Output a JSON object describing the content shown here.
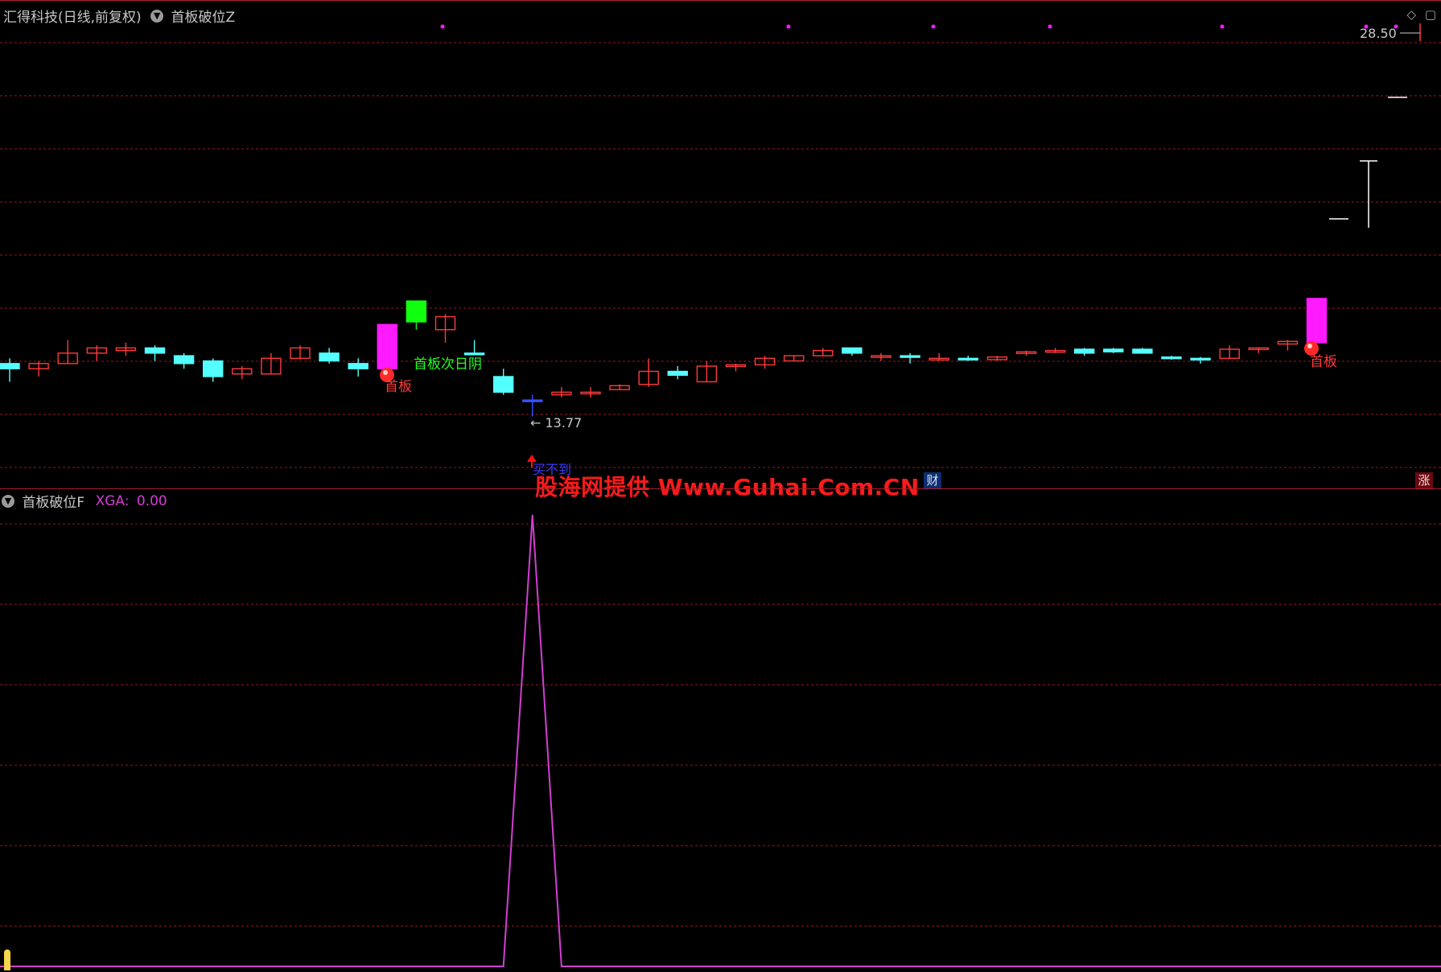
{
  "top_panel": {
    "stock_title": "汇得科技(日线,前复权)",
    "indicator_name": "首板破位Z",
    "top_price": "28.50",
    "low_price_label": "13.77",
    "signal_labels": {
      "first_board_1": "首板",
      "first_board_2": "首板",
      "next_day_yin": "首板次日阴",
      "break_label": "买不到"
    }
  },
  "bottom_panel": {
    "indicator_name": "首板破位F",
    "xga_label": "XGA:",
    "xga_value": "0.00"
  },
  "watermark": "股海网提供 Www.Guhai.Com.CN",
  "badges": {
    "cai": "财",
    "zhang": "涨"
  },
  "icons": [
    "chevron-down-icon",
    "diamond-icon",
    "window-restore-icon"
  ],
  "colors": {
    "up": "#ff3a3a",
    "down": "#54ffff",
    "limit_up": "#ff1aff",
    "green": "#11ff11",
    "grid": "#a0141c",
    "indicator_line": "#d23fd2"
  },
  "chart_data": [
    {
      "type": "candlestick",
      "title": "汇得科技(日线,前复权)",
      "series": [
        {
          "o": 15.8,
          "h": 16.0,
          "l": 15.1,
          "c": 15.6,
          "d": "down"
        },
        {
          "o": 15.6,
          "h": 15.9,
          "l": 15.3,
          "c": 15.8,
          "d": "up"
        },
        {
          "o": 15.8,
          "h": 16.7,
          "l": 15.8,
          "c": 16.2,
          "d": "up"
        },
        {
          "o": 16.2,
          "h": 16.5,
          "l": 15.9,
          "c": 16.4,
          "d": "up"
        },
        {
          "o": 16.3,
          "h": 16.6,
          "l": 16.1,
          "c": 16.4,
          "d": "up"
        },
        {
          "o": 16.4,
          "h": 16.5,
          "l": 15.9,
          "c": 16.2,
          "d": "down"
        },
        {
          "o": 16.1,
          "h": 16.2,
          "l": 15.6,
          "c": 15.8,
          "d": "down"
        },
        {
          "o": 15.9,
          "h": 16.0,
          "l": 15.1,
          "c": 15.3,
          "d": "down"
        },
        {
          "o": 15.4,
          "h": 15.7,
          "l": 15.2,
          "c": 15.6,
          "d": "up"
        },
        {
          "o": 15.4,
          "h": 16.2,
          "l": 15.4,
          "c": 16.0,
          "d": "up"
        },
        {
          "o": 16.0,
          "h": 16.5,
          "l": 16.0,
          "c": 16.4,
          "d": "up"
        },
        {
          "o": 16.2,
          "h": 16.4,
          "l": 15.8,
          "c": 15.9,
          "d": "down"
        },
        {
          "o": 15.8,
          "h": 16.0,
          "l": 15.3,
          "c": 15.6,
          "d": "down"
        },
        {
          "o": 15.6,
          "h": 17.3,
          "l": 15.6,
          "c": 17.3,
          "d": "limit"
        },
        {
          "o": 18.2,
          "h": 18.2,
          "l": 17.1,
          "c": 17.4,
          "d": "green"
        },
        {
          "o": 17.1,
          "h": 17.7,
          "l": 16.6,
          "c": 17.6,
          "d": "up"
        },
        {
          "o": 16.2,
          "h": 16.7,
          "l": 16.2,
          "c": 16.2,
          "d": "down"
        },
        {
          "o": 15.3,
          "h": 15.6,
          "l": 14.6,
          "c": 14.7,
          "d": "down"
        },
        {
          "o": 14.4,
          "h": 14.6,
          "l": 13.77,
          "c": 14.4,
          "d": "blue"
        },
        {
          "o": 14.6,
          "h": 14.9,
          "l": 14.5,
          "c": 14.7,
          "d": "up"
        },
        {
          "o": 14.7,
          "h": 14.9,
          "l": 14.5,
          "c": 14.7,
          "d": "up"
        },
        {
          "o": 14.8,
          "h": 15.0,
          "l": 14.8,
          "c": 14.95,
          "d": "up"
        },
        {
          "o": 15.0,
          "h": 16.0,
          "l": 14.9,
          "c": 15.5,
          "d": "up"
        },
        {
          "o": 15.5,
          "h": 15.7,
          "l": 15.2,
          "c": 15.35,
          "d": "down"
        },
        {
          "o": 15.1,
          "h": 15.9,
          "l": 15.1,
          "c": 15.7,
          "d": "up"
        },
        {
          "o": 15.7,
          "h": 15.8,
          "l": 15.5,
          "c": 15.75,
          "d": "up"
        },
        {
          "o": 15.75,
          "h": 16.1,
          "l": 15.6,
          "c": 16.0,
          "d": "up"
        },
        {
          "o": 15.9,
          "h": 16.1,
          "l": 15.9,
          "c": 16.1,
          "d": "up"
        },
        {
          "o": 16.1,
          "h": 16.4,
          "l": 16.1,
          "c": 16.3,
          "d": "up"
        },
        {
          "o": 16.4,
          "h": 16.4,
          "l": 16.1,
          "c": 16.2,
          "d": "down"
        },
        {
          "o": 16.1,
          "h": 16.2,
          "l": 15.9,
          "c": 16.1,
          "d": "up"
        },
        {
          "o": 16.1,
          "h": 16.2,
          "l": 15.8,
          "c": 16.1,
          "d": "down"
        },
        {
          "o": 16.0,
          "h": 16.2,
          "l": 15.9,
          "c": 16.0,
          "d": "up"
        },
        {
          "o": 16.0,
          "h": 16.1,
          "l": 15.9,
          "c": 16.0,
          "d": "down"
        },
        {
          "o": 15.95,
          "h": 16.1,
          "l": 15.9,
          "c": 16.05,
          "d": "up"
        },
        {
          "o": 16.2,
          "h": 16.3,
          "l": 16.1,
          "c": 16.25,
          "d": "up"
        },
        {
          "o": 16.3,
          "h": 16.4,
          "l": 16.2,
          "c": 16.3,
          "d": "up"
        },
        {
          "o": 16.35,
          "h": 16.4,
          "l": 16.1,
          "c": 16.2,
          "d": "down"
        },
        {
          "o": 16.35,
          "h": 16.4,
          "l": 16.2,
          "c": 16.25,
          "d": "down"
        },
        {
          "o": 16.35,
          "h": 16.4,
          "l": 16.2,
          "c": 16.2,
          "d": "down"
        },
        {
          "o": 16.05,
          "h": 16.1,
          "l": 15.95,
          "c": 16.0,
          "d": "down"
        },
        {
          "o": 16.0,
          "h": 16.05,
          "l": 15.8,
          "c": 15.95,
          "d": "down"
        },
        {
          "o": 16.0,
          "h": 16.5,
          "l": 16.0,
          "c": 16.35,
          "d": "up"
        },
        {
          "o": 16.4,
          "h": 16.4,
          "l": 16.2,
          "c": 16.4,
          "d": "up"
        },
        {
          "o": 16.55,
          "h": 16.7,
          "l": 16.3,
          "c": 16.65,
          "d": "up"
        },
        {
          "o": 16.6,
          "h": 18.3,
          "l": 16.6,
          "c": 18.3,
          "d": "limit"
        }
      ],
      "extra": [
        {
          "label": "far-right bars",
          "values": [
            22.5,
            24.0,
            22.2,
            26.3,
            28.5
          ]
        }
      ],
      "ylim": [
        11.5,
        28.8
      ]
    },
    {
      "type": "line",
      "title": "首板破位F",
      "series": [
        {
          "name": "XGA",
          "values": [
            0,
            0,
            0,
            0,
            0,
            0,
            0,
            0,
            0,
            0,
            0,
            0,
            0,
            0,
            0,
            0,
            0,
            0,
            1,
            0,
            0,
            0,
            0,
            0,
            0,
            0,
            0,
            0,
            0,
            0,
            0,
            0,
            0,
            0,
            0,
            0,
            0,
            0,
            0,
            0,
            0,
            0,
            0,
            0,
            0,
            0
          ]
        }
      ],
      "ylim": [
        0,
        1
      ]
    }
  ]
}
